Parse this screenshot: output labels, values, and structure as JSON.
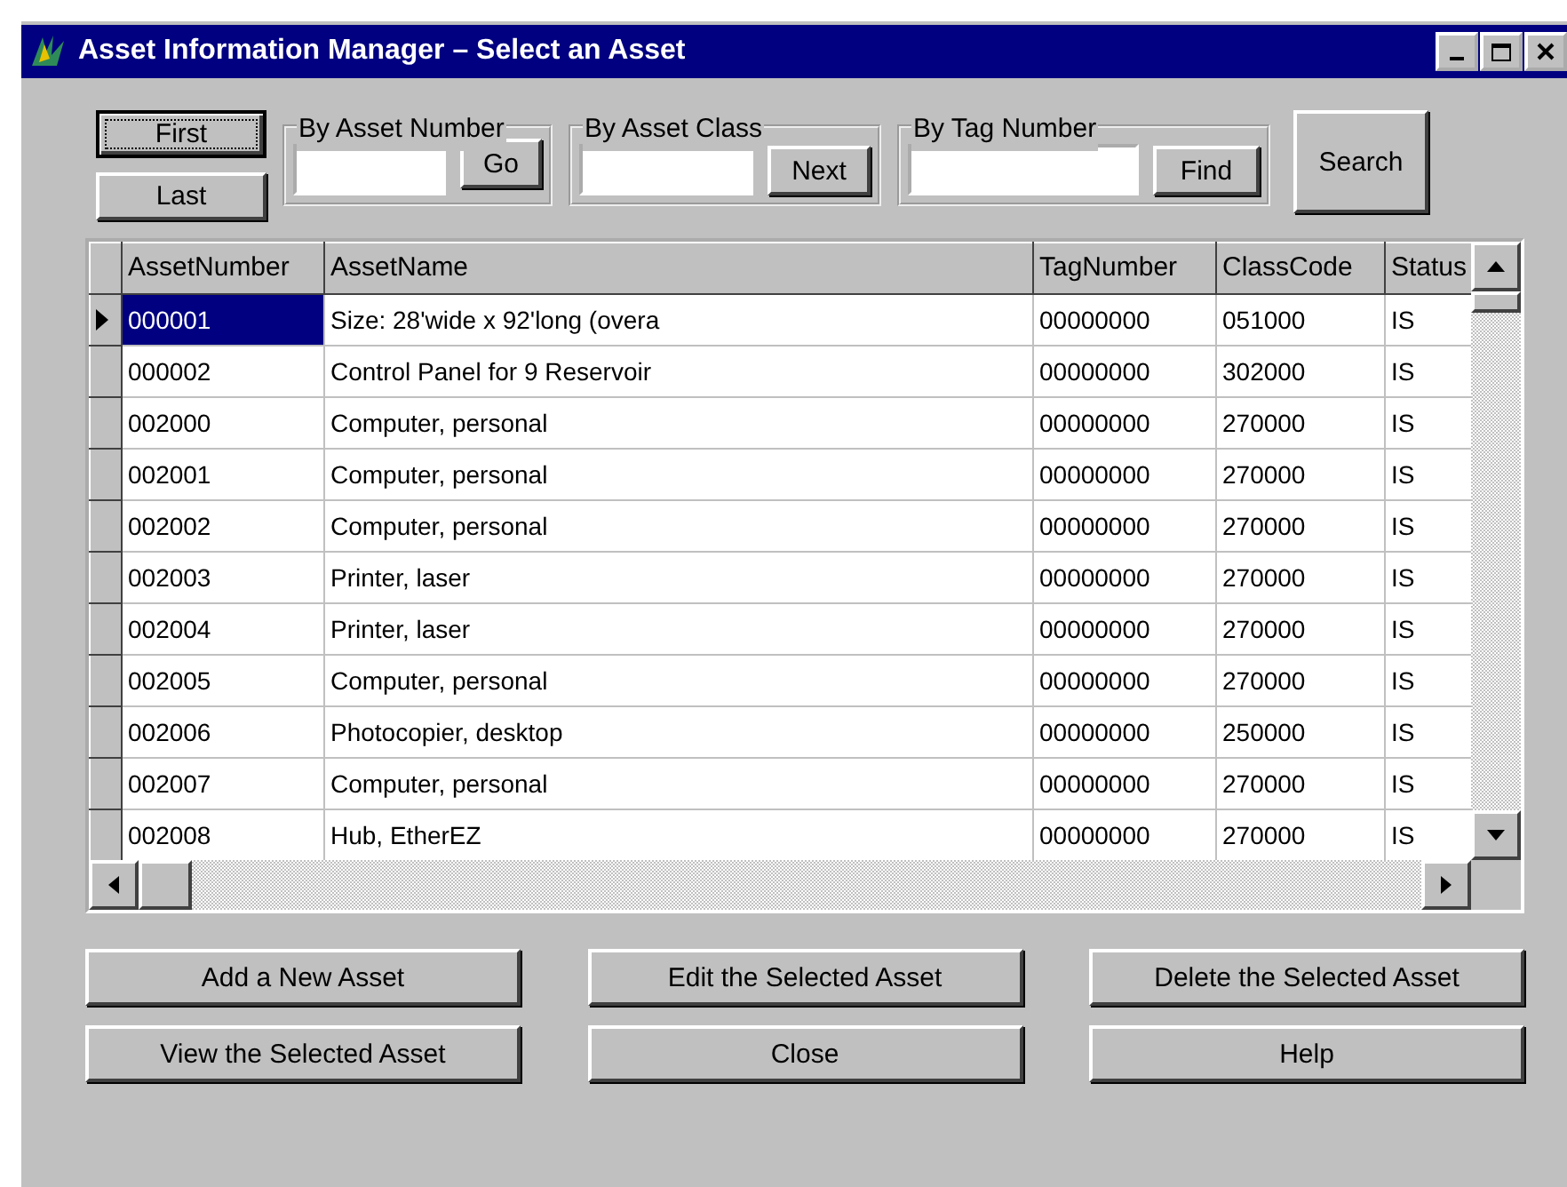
{
  "window": {
    "title": "Asset Information Manager – Select an Asset"
  },
  "nav_buttons": [
    {
      "label": "First",
      "focused": true
    },
    {
      "label": "Last",
      "focused": false
    }
  ],
  "search_groups": [
    {
      "legend": "By Asset Number",
      "button": "Go"
    },
    {
      "legend": "By Asset Class",
      "button": "Next"
    },
    {
      "legend": "By Tag Number",
      "button": "Find"
    }
  ],
  "search_button": "Search",
  "table": {
    "columns": [
      "AssetNumber",
      "AssetName",
      "TagNumber",
      "ClassCode",
      "Status"
    ],
    "rows": [
      {
        "selected": true,
        "cells": [
          "000001",
          "Size: 28'wide x 92'long (overa",
          "00000000",
          "051000",
          "IS"
        ]
      },
      {
        "selected": false,
        "cells": [
          "000002",
          "Control Panel for 9 Reservoir",
          "00000000",
          "302000",
          "IS"
        ]
      },
      {
        "selected": false,
        "cells": [
          "002000",
          "Computer, personal",
          "00000000",
          "270000",
          "IS"
        ]
      },
      {
        "selected": false,
        "cells": [
          "002001",
          "Computer, personal",
          "00000000",
          "270000",
          "IS"
        ]
      },
      {
        "selected": false,
        "cells": [
          "002002",
          "Computer, personal",
          "00000000",
          "270000",
          "IS"
        ]
      },
      {
        "selected": false,
        "cells": [
          "002003",
          "Printer, laser",
          "00000000",
          "270000",
          "IS"
        ]
      },
      {
        "selected": false,
        "cells": [
          "002004",
          "Printer, laser",
          "00000000",
          "270000",
          "IS"
        ]
      },
      {
        "selected": false,
        "cells": [
          "002005",
          "Computer, personal",
          "00000000",
          "270000",
          "IS"
        ]
      },
      {
        "selected": false,
        "cells": [
          "002006",
          "Photocopier, desktop",
          "00000000",
          "250000",
          "IS"
        ]
      },
      {
        "selected": false,
        "cells": [
          "002007",
          "Computer, personal",
          "00000000",
          "270000",
          "IS"
        ]
      },
      {
        "selected": false,
        "cells": [
          "002008",
          "Hub, EtherEZ",
          "00000000",
          "270000",
          "IS"
        ]
      }
    ]
  },
  "action_buttons": [
    [
      "Add a New Asset",
      "Edit the Selected Asset",
      "Delete the Selected Asset"
    ],
    [
      "View the Selected Asset",
      "Close",
      "Help"
    ]
  ]
}
